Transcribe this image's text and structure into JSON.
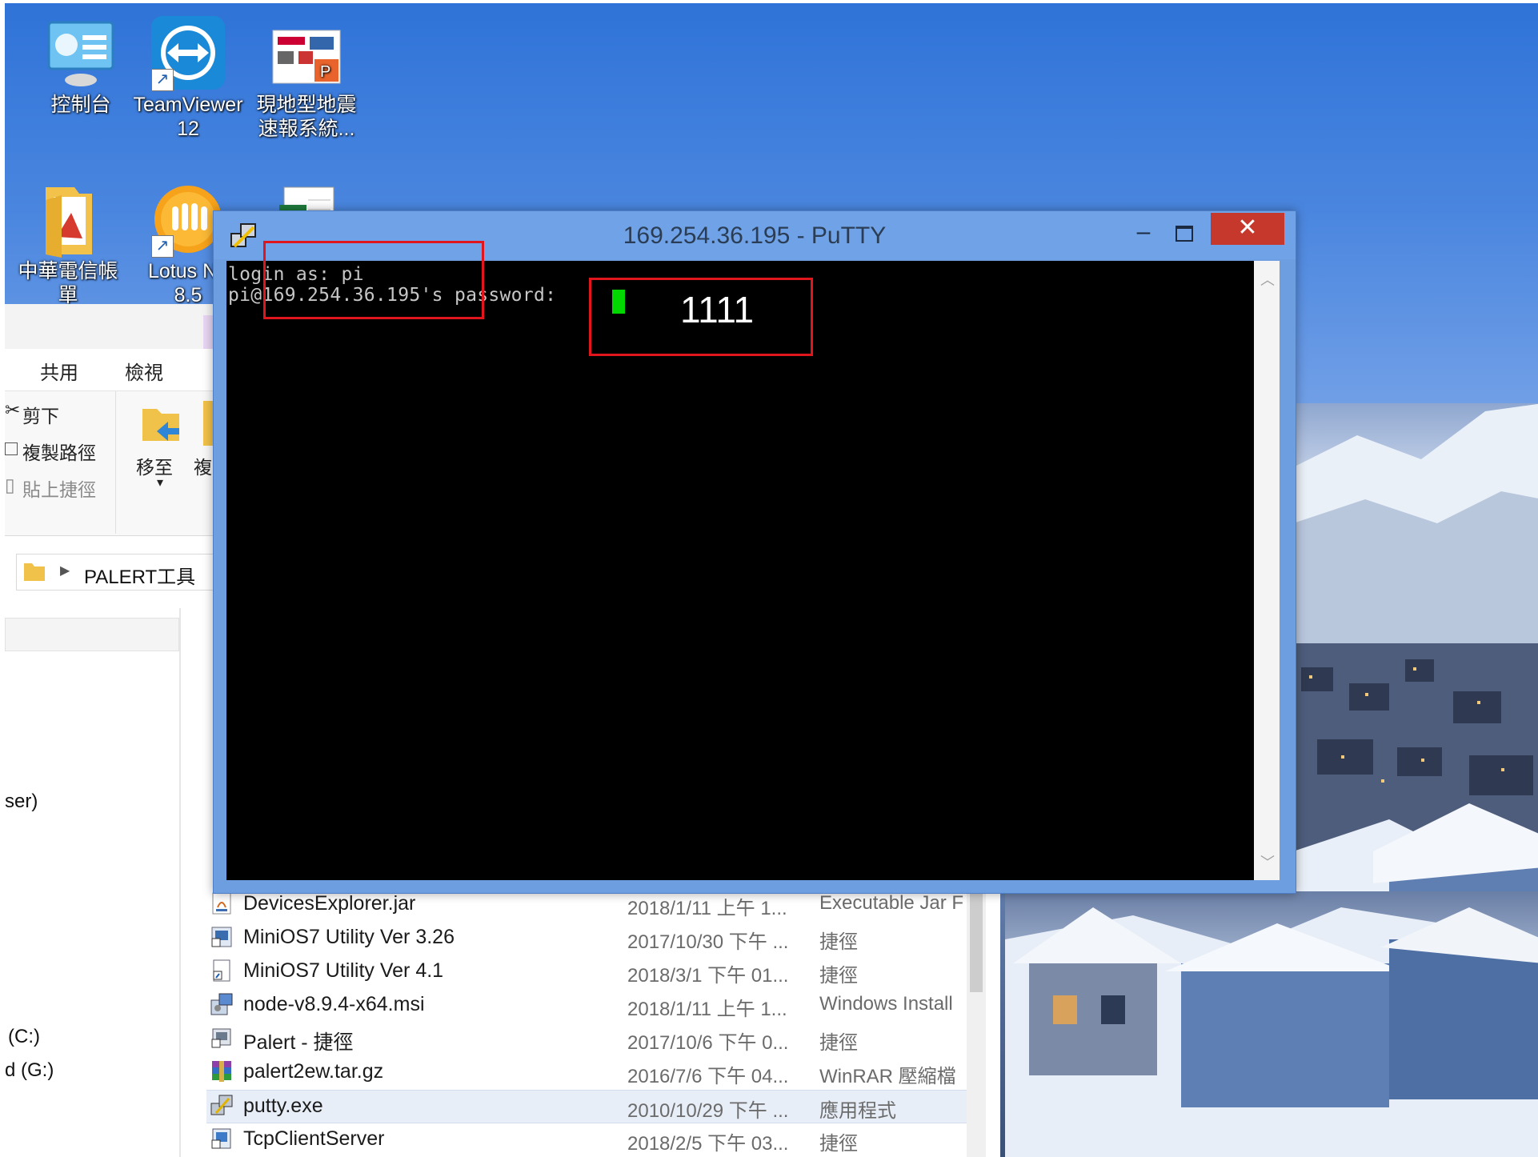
{
  "desktop": {
    "icons": [
      {
        "label1": "控制台",
        "label2": ""
      },
      {
        "label1": "TeamViewer",
        "label2": "12"
      },
      {
        "label1": "現地型地震",
        "label2": "速報系統..."
      },
      {
        "label1": "中華電信帳",
        "label2": "單"
      },
      {
        "label1": "Lotus No",
        "label2": "8.5"
      }
    ]
  },
  "explorer": {
    "tabs": [
      "共用",
      "檢視"
    ],
    "ribbon": {
      "cut": "剪下",
      "copy_path": "複製路徑",
      "paste_shortcut": "貼上捷徑",
      "move_to": "移至",
      "copy_to": "複"
    },
    "address": "PALERT工具",
    "nav": {
      "user_fragment": "ser)",
      "drive_c": "(C:)",
      "drive_g": "d (G:)"
    },
    "files": [
      {
        "name": "DevicesExplorer.jar",
        "date": "2018/1/11 上午 1...",
        "type": "Executable Jar F"
      },
      {
        "name": "MiniOS7 Utility Ver 3.26",
        "date": "2017/10/30 下午 ...",
        "type": "捷徑"
      },
      {
        "name": "MiniOS7 Utility Ver 4.1",
        "date": "2018/3/1 下午 01...",
        "type": "捷徑"
      },
      {
        "name": "node-v8.9.4-x64.msi",
        "date": "2018/1/11 上午 1...",
        "type": "Windows Install"
      },
      {
        "name": "Palert - 捷徑",
        "date": "2017/10/6 下午 0...",
        "type": "捷徑"
      },
      {
        "name": "palert2ew.tar.gz",
        "date": "2016/7/6 下午 04...",
        "type": "WinRAR 壓縮檔"
      },
      {
        "name": "putty.exe",
        "date": "2010/10/29 下午 ...",
        "type": "應用程式"
      },
      {
        "name": "TcpClientServer",
        "date": "2018/2/5 下午 03...",
        "type": "捷徑"
      }
    ]
  },
  "putty": {
    "title": "169.254.36.195 - PuTTY",
    "close_glyph": "✕",
    "minimize_glyph": "–",
    "lines": [
      "login as: pi",
      "pi@169.254.36.195's password: "
    ]
  },
  "annotation": {
    "password_note": "1111",
    "color": "#e0161c"
  }
}
